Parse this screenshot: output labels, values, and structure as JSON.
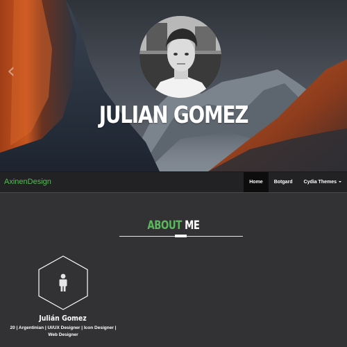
{
  "hero": {
    "name": "JULIAN GOMEZ",
    "prev_arrow": "‹",
    "avatar_icon": "profile-photo"
  },
  "navbar": {
    "brand": "AxinenDesign",
    "items": [
      {
        "label": "Home",
        "active": true
      },
      {
        "label": "Botgard",
        "active": false
      },
      {
        "label": "Cydia Themes",
        "active": false,
        "dropdown": true
      }
    ]
  },
  "about": {
    "title_highlight": "ABOUT",
    "title_rest": "ME",
    "card_icon": "user-icon",
    "person_name": "Julián Gomez",
    "person_desc": "20 | Argentinian | UI/UX Designer | Icon Designer | Web Designer"
  },
  "colors": {
    "accent": "#5cb85c",
    "page_bg": "#323235",
    "navbar_bg": "#222224"
  }
}
